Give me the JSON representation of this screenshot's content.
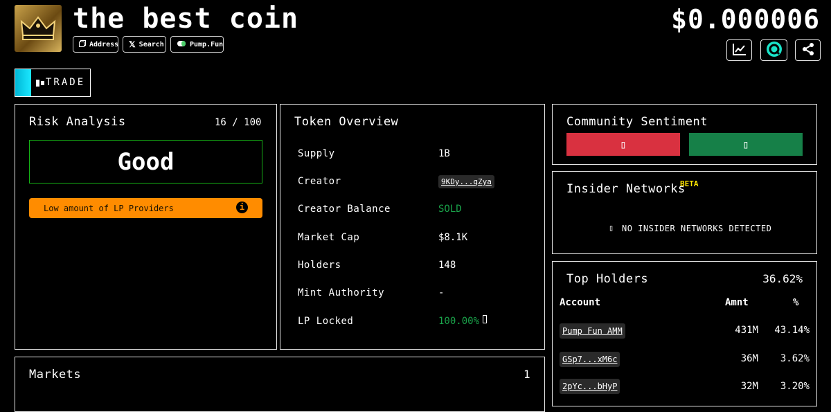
{
  "token": {
    "name": "the best coin",
    "price": "$0.000006"
  },
  "links": {
    "address": "Address",
    "search": "Search",
    "pumpfun": "Pump.Fun"
  },
  "trade_label": "TRADE",
  "risk": {
    "title": "Risk Analysis",
    "score": "16 / 100",
    "rating": "Good",
    "warning": "Low amount of LP Providers",
    "info_glyph": "i"
  },
  "overview": {
    "title": "Token Overview",
    "rows": [
      {
        "label": "Supply",
        "value": "1B"
      },
      {
        "label": "Creator",
        "value": "9KDy...qZya"
      },
      {
        "label": "Creator Balance",
        "value": "SOLD"
      },
      {
        "label": "Market Cap",
        "value": "$8.1K"
      },
      {
        "label": "Holders",
        "value": "148"
      },
      {
        "label": "Mint Authority",
        "value": "-"
      },
      {
        "label": "LP Locked",
        "value": "100.00%"
      }
    ]
  },
  "sentiment": {
    "title": "Community Sentiment",
    "down_glyph": "▯",
    "up_glyph": "▯"
  },
  "insider": {
    "title": "Insider Networks",
    "badge": "BETA",
    "icon_glyph": "▯",
    "message": "NO INSIDER NETWORKS DETECTED"
  },
  "holders": {
    "title": "Top Holders",
    "total": "36.62%",
    "columns": [
      "Account",
      "Amnt",
      "%"
    ],
    "rows": [
      {
        "account": "Pump Fun AMM",
        "amount": "431M",
        "pct": "43.14%"
      },
      {
        "account": "GSp7...xM6c",
        "amount": "36M",
        "pct": "3.62%"
      },
      {
        "account": "2pYc...bHyP",
        "amount": "32M",
        "pct": "3.20%"
      }
    ]
  },
  "markets": {
    "title": "Markets",
    "count": "1"
  },
  "colors": {
    "good_border": "#16b316",
    "warning": "#ff8c00",
    "sold": "#1aa34a",
    "vote_down": "#d93140",
    "vote_up": "#168048",
    "beta": "#ffe600",
    "trade_accent": "#1ce8ff"
  }
}
